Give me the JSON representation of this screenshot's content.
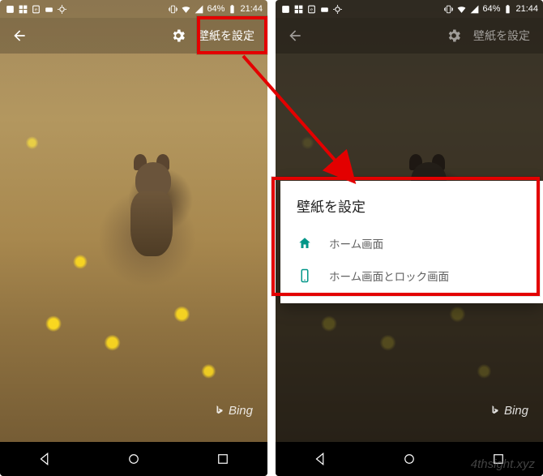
{
  "status": {
    "battery_text": "64%",
    "time": "21:44"
  },
  "appbar": {
    "set_wallpaper_label": "壁紙を設定"
  },
  "attribution": {
    "label": "Bing"
  },
  "dialog": {
    "title": "壁紙を設定",
    "option_home": "ホーム画面",
    "option_home_lock": "ホーム画面とロック画面"
  },
  "watermark": "4thsight.xyz"
}
